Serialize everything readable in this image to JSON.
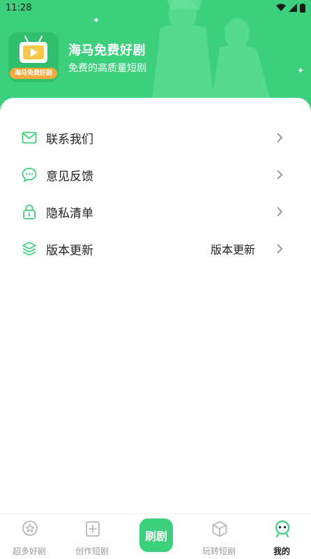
{
  "status_bar": {
    "time": "11:28"
  },
  "app": {
    "name": "海马免费好剧",
    "slogan": "免费的高质量短剧",
    "logo_caption": "海马免费好剧"
  },
  "menu": [
    {
      "label": "联系我们",
      "value": "",
      "icon": "mail-icon"
    },
    {
      "label": "意见反馈",
      "value": "",
      "icon": "chat-bubble-icon"
    },
    {
      "label": "隐私清单",
      "value": "",
      "icon": "lock-icon"
    },
    {
      "label": "版本更新",
      "value": "版本更新",
      "icon": "layers-icon"
    }
  ],
  "tabs": [
    {
      "label": "超多好剧",
      "icon": "star-badge-icon"
    },
    {
      "label": "创作短剧",
      "icon": "add-square-icon"
    },
    {
      "label": "刷剧",
      "icon": "center-action"
    },
    {
      "label": "玩转短剧",
      "icon": "cube-icon"
    },
    {
      "label": "我的",
      "icon": "profile-icon"
    }
  ],
  "colors": {
    "brand": "#3dd07c",
    "logo_accent": "#f5a93a"
  }
}
